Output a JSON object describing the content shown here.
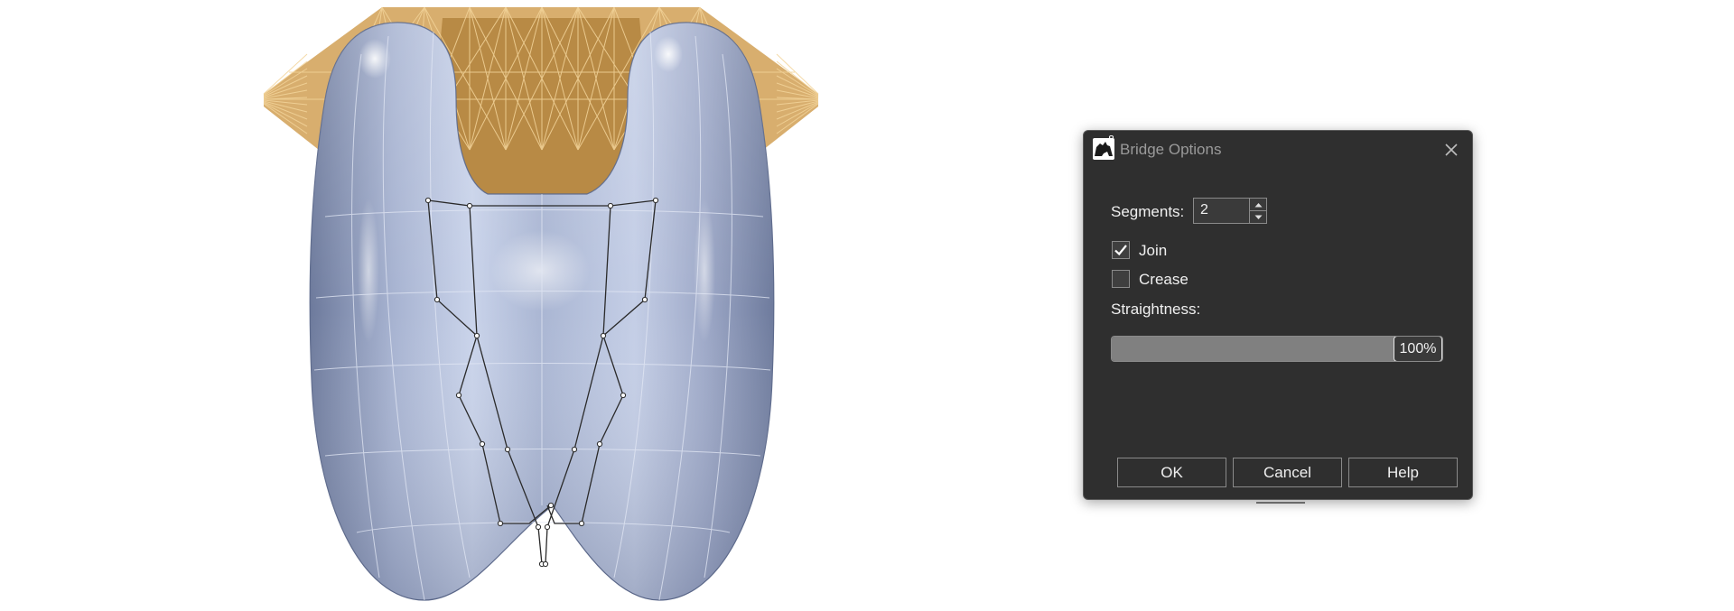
{
  "dialog": {
    "title": "Bridge Options",
    "app_version_badge": "8",
    "segments_label": "Segments:",
    "segments_value": "2",
    "join_label": "Join",
    "join_checked": true,
    "crease_label": "Crease",
    "crease_checked": false,
    "straightness_label": "Straightness:",
    "straightness_value": "100%",
    "straightness_fraction": 1.0,
    "buttons": {
      "ok": "OK",
      "cancel": "Cancel",
      "help": "Help"
    }
  },
  "icons": {
    "app": "rhino-logo-icon",
    "close": "close-icon",
    "spin_up": "spin-up-arrow-icon",
    "spin_down": "spin-down-arrow-icon",
    "check": "checkmark-icon"
  },
  "colors": {
    "dialog_bg": "#2f2f2f",
    "model_surface": "#9ba8c7",
    "model_wire": "#e8b86a",
    "slider_fill": "#808080"
  }
}
